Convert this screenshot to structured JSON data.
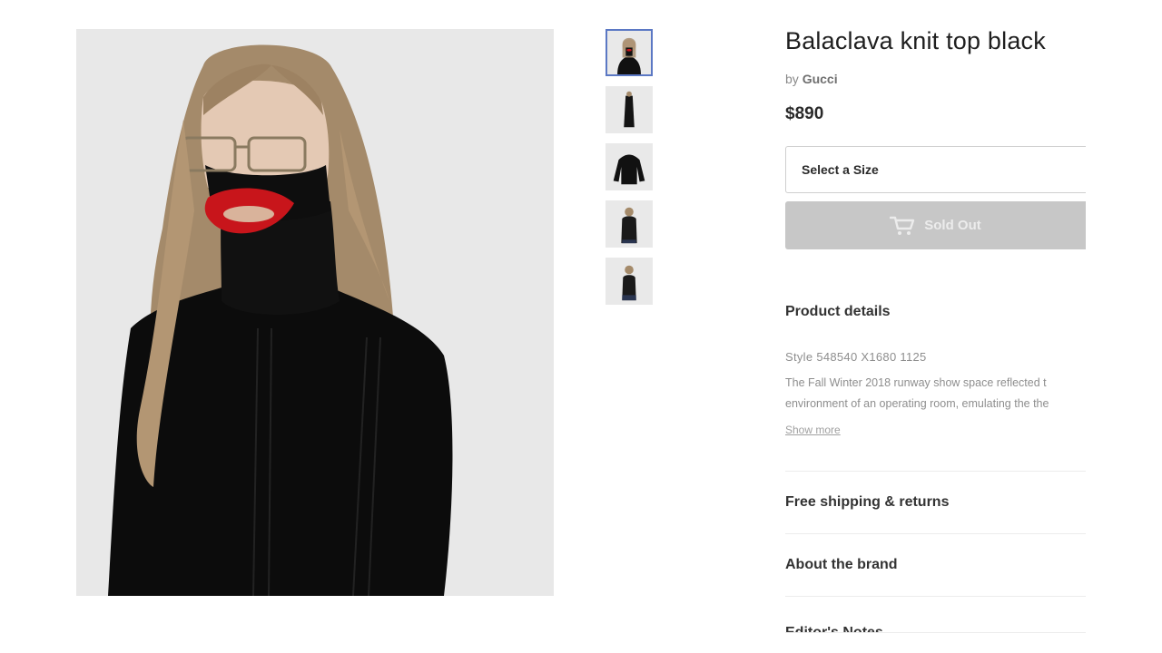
{
  "product": {
    "title": "Balaclava knit top black",
    "by_prefix": "by",
    "brand": "Gucci",
    "price": "$890",
    "main_image_alt": "",
    "thumbnail_count": 5,
    "active_thumbnail": 0
  },
  "size_select": {
    "placeholder": "Select a Size"
  },
  "buy_button": {
    "label": "Sold Out",
    "icon": "cart-icon"
  },
  "details": {
    "heading": "Product details",
    "style": "Style 548540 X1680 1125",
    "description_lines": [
      "The Fall Winter 2018 runway show space reflected t",
      "environment of an operating room, emulating the the"
    ],
    "show_more": "Show more"
  },
  "accordion": [
    {
      "label": "Free shipping & returns"
    },
    {
      "label": "About the brand"
    },
    {
      "label": "Editor's Notes"
    }
  ],
  "colors": {
    "sold_out_bg": "#c7c7c7",
    "image_bg": "#e8e8e8",
    "thumb_active_border": "#5b78c4",
    "lip_red": "#c8151b"
  }
}
